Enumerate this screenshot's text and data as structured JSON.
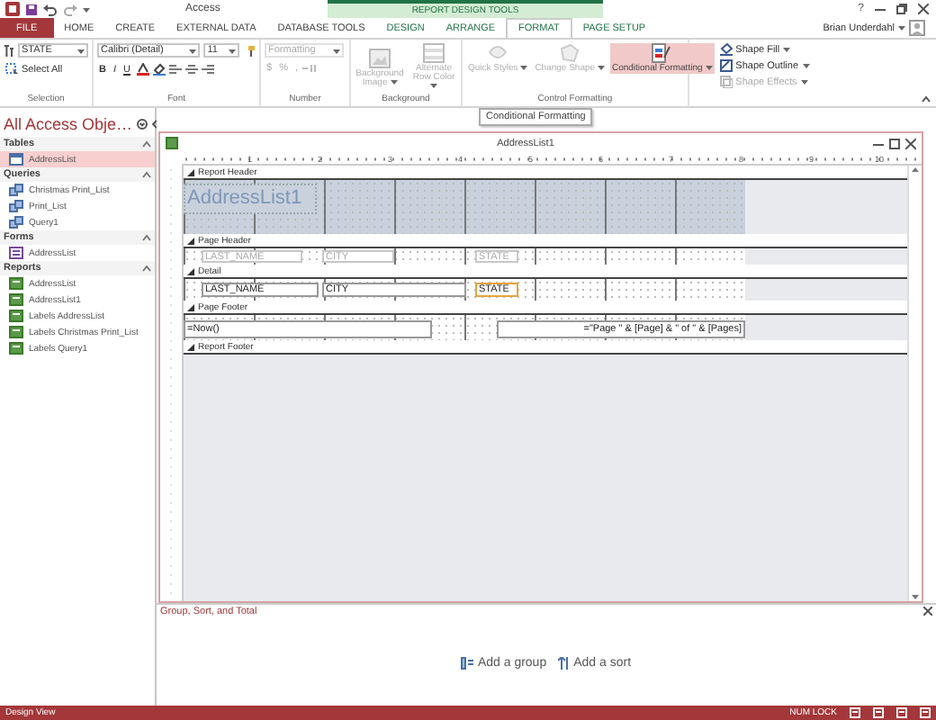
{
  "title_bar": {
    "title": "Access",
    "context_tab_group": "REPORT DESIGN TOOLS",
    "help": "?"
  },
  "ribbon_tabs": [
    {
      "label": "FILE",
      "kind": "file",
      "selected": false
    },
    {
      "label": "HOME",
      "kind": "main",
      "selected": false
    },
    {
      "label": "CREATE",
      "kind": "main",
      "selected": false
    },
    {
      "label": "EXTERNAL DATA",
      "kind": "main",
      "selected": false
    },
    {
      "label": "DATABASE TOOLS",
      "kind": "main",
      "selected": false
    },
    {
      "label": "DESIGN",
      "kind": "context",
      "selected": false
    },
    {
      "label": "ARRANGE",
      "kind": "context",
      "selected": false
    },
    {
      "label": "FORMAT",
      "kind": "context",
      "selected": true
    },
    {
      "label": "PAGE SETUP",
      "kind": "context",
      "selected": false
    }
  ],
  "user": {
    "name": "Brian Underdahl"
  },
  "ribbon_groups": [
    {
      "kind": "selection",
      "label": "Selection",
      "object": "STATE",
      "select_all": "Select All"
    },
    {
      "kind": "font",
      "label": "Font",
      "font_name": "Calibri (Detail)",
      "font_size": "11",
      "styles": [
        "B",
        "I",
        "U"
      ]
    },
    {
      "kind": "number",
      "label": "Number",
      "format": "Formatting",
      "symbols": [
        "$",
        "%",
        ","
      ],
      "disabled": true
    },
    {
      "kind": "background",
      "label": "Background",
      "buttons": [
        {
          "label": "Background Image",
          "disabled": true
        },
        {
          "label": "Alternate Row Color",
          "disabled": true
        }
      ]
    },
    {
      "kind": "control_formatting",
      "label": "Control Formatting",
      "buttons": [
        {
          "label": "Quick Styles",
          "disabled": true,
          "selected": false
        },
        {
          "label": "Change Shape",
          "disabled": true,
          "selected": false
        },
        {
          "label": "Conditional Formatting",
          "disabled": false,
          "selected": true
        }
      ],
      "small_buttons": [
        {
          "label": "Shape Fill",
          "disabled": false
        },
        {
          "label": "Shape Outline",
          "disabled": false
        },
        {
          "label": "Shape Effects",
          "disabled": true
        }
      ]
    }
  ],
  "tooltip": "Conditional Formatting",
  "navigation_pane": {
    "title": "All Access Obje…",
    "groups": [
      {
        "label": "Tables",
        "items": [
          {
            "label": "AddressList",
            "kind": "table",
            "selected": true
          }
        ]
      },
      {
        "label": "Queries",
        "items": [
          {
            "label": "Christmas Print_List",
            "kind": "query",
            "selected": false
          },
          {
            "label": "Print_List",
            "kind": "query",
            "selected": false
          },
          {
            "label": "Query1",
            "kind": "query",
            "selected": false
          }
        ]
      },
      {
        "label": "Forms",
        "items": [
          {
            "label": "AddressList",
            "kind": "form",
            "selected": false
          }
        ]
      },
      {
        "label": "Reports",
        "items": [
          {
            "label": "AddressList",
            "kind": "report",
            "selected": false
          },
          {
            "label": "AddressList1",
            "kind": "report",
            "selected": false
          },
          {
            "label": "Labels AddressList",
            "kind": "report",
            "selected": false
          },
          {
            "label": "Labels Christmas Print_List",
            "kind": "report",
            "selected": false
          },
          {
            "label": "Labels Query1",
            "kind": "report",
            "selected": false
          }
        ]
      }
    ]
  },
  "report_window": {
    "title": "AddressList1",
    "ruler": [
      "1",
      "2",
      "3",
      "4",
      "5",
      "6",
      "7",
      "8",
      "9",
      "10"
    ],
    "sections": [
      {
        "label": "Report Header",
        "kind": "report_header",
        "controls": [
          {
            "text": "AddressList1",
            "kind": "title",
            "selected": false
          }
        ]
      },
      {
        "label": "Page Header",
        "kind": "page_header",
        "controls": [
          {
            "text": "LAST_NAME",
            "kind": "label",
            "selected": false
          },
          {
            "text": "CITY",
            "kind": "label",
            "selected": false
          },
          {
            "text": "STATE",
            "kind": "label",
            "selected": false
          }
        ]
      },
      {
        "label": "Detail",
        "kind": "detail",
        "controls": [
          {
            "text": "LAST_NAME",
            "kind": "textbox",
            "selected": false
          },
          {
            "text": "CITY",
            "kind": "textbox",
            "selected": false
          },
          {
            "text": "STATE",
            "kind": "textbox",
            "selected": true
          }
        ]
      },
      {
        "label": "Page Footer",
        "kind": "page_footer",
        "controls": [
          {
            "text": "=Now()",
            "kind": "textbox",
            "selected": false
          },
          {
            "text": "=\"Page \" & [Page] & \" of \" & [Pages]",
            "kind": "textbox",
            "selected": false
          }
        ]
      },
      {
        "label": "Report Footer",
        "kind": "report_footer"
      }
    ]
  },
  "group_sort_total": {
    "title": "Group, Sort, and Total",
    "actions": [
      {
        "kind": "group",
        "label": "Add a group"
      },
      {
        "kind": "sort",
        "label": "Add a sort"
      }
    ]
  },
  "status_bar": {
    "mode": "Design View",
    "indicators": [
      "NUM LOCK"
    ]
  }
}
